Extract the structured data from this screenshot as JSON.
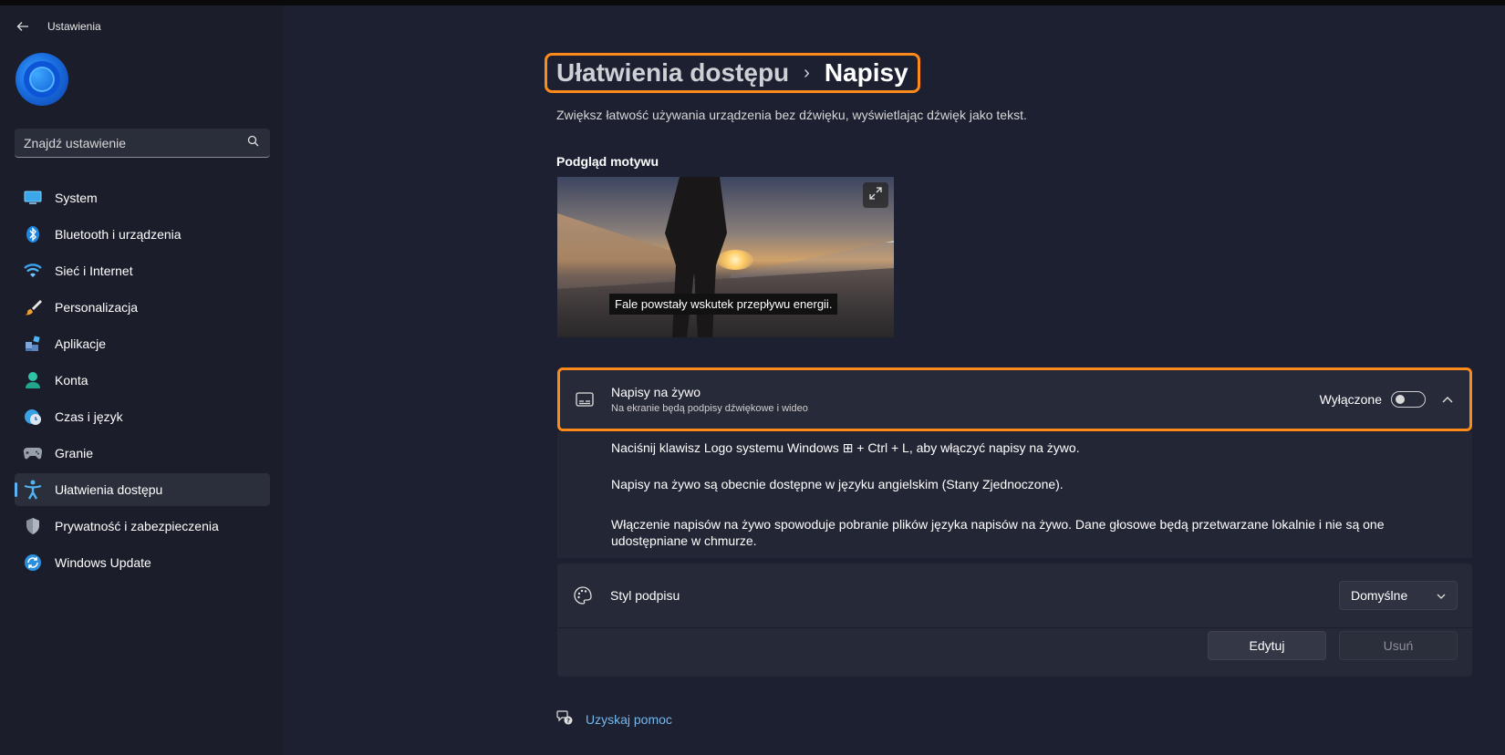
{
  "app": {
    "title": "Ustawienia"
  },
  "search": {
    "placeholder": "Znajdź ustawienie"
  },
  "sidebar": {
    "items": [
      {
        "label": "System",
        "icon": "monitor-icon"
      },
      {
        "label": "Bluetooth i urządzenia",
        "icon": "bluetooth-icon"
      },
      {
        "label": "Sieć i Internet",
        "icon": "wifi-icon"
      },
      {
        "label": "Personalizacja",
        "icon": "brush-icon"
      },
      {
        "label": "Aplikacje",
        "icon": "apps-icon"
      },
      {
        "label": "Konta",
        "icon": "person-icon"
      },
      {
        "label": "Czas i język",
        "icon": "clock-globe-icon"
      },
      {
        "label": "Granie",
        "icon": "gamepad-icon"
      },
      {
        "label": "Ułatwienia dostępu",
        "icon": "accessibility-icon",
        "active": true
      },
      {
        "label": "Prywatność i zabezpieczenia",
        "icon": "shield-icon"
      },
      {
        "label": "Windows Update",
        "icon": "sync-icon"
      }
    ]
  },
  "breadcrumb": {
    "parent": "Ułatwienia dostępu",
    "separator": "›",
    "current": "Napisy"
  },
  "subtitle": "Zwiększ łatwość używania urządzenia bez dźwięku, wyświetlając dźwięk jako tekst.",
  "preview": {
    "label": "Podgląd motywu",
    "caption": "Fale powstały wskutek przepływu energii."
  },
  "live_captions": {
    "title": "Napisy na żywo",
    "description": "Na ekranie będą podpisy dźwiękowe i wideo",
    "toggle_state": "Wyłączone",
    "toggle_on": false,
    "details": [
      "Naciśnij klawisz Logo systemu Windows ⊞ + Ctrl + L, aby włączyć napisy na żywo.",
      "Napisy na żywo są obecnie dostępne w języku angielskim (Stany Zjednoczone).",
      "Włączenie napisów na żywo spowoduje pobranie plików języka napisów na żywo. Dane głosowe będą przetwarzane lokalnie i nie są one udostępniane w chmurze."
    ]
  },
  "caption_style": {
    "label": "Styl podpisu",
    "selected": "Domyślne",
    "edit_label": "Edytuj",
    "remove_label": "Usuń"
  },
  "help": {
    "label": "Uzyskaj pomoc"
  },
  "colors": {
    "accent": "#ff8a1c",
    "link": "#74b9ee",
    "active_indicator": "#5fb2f2"
  }
}
